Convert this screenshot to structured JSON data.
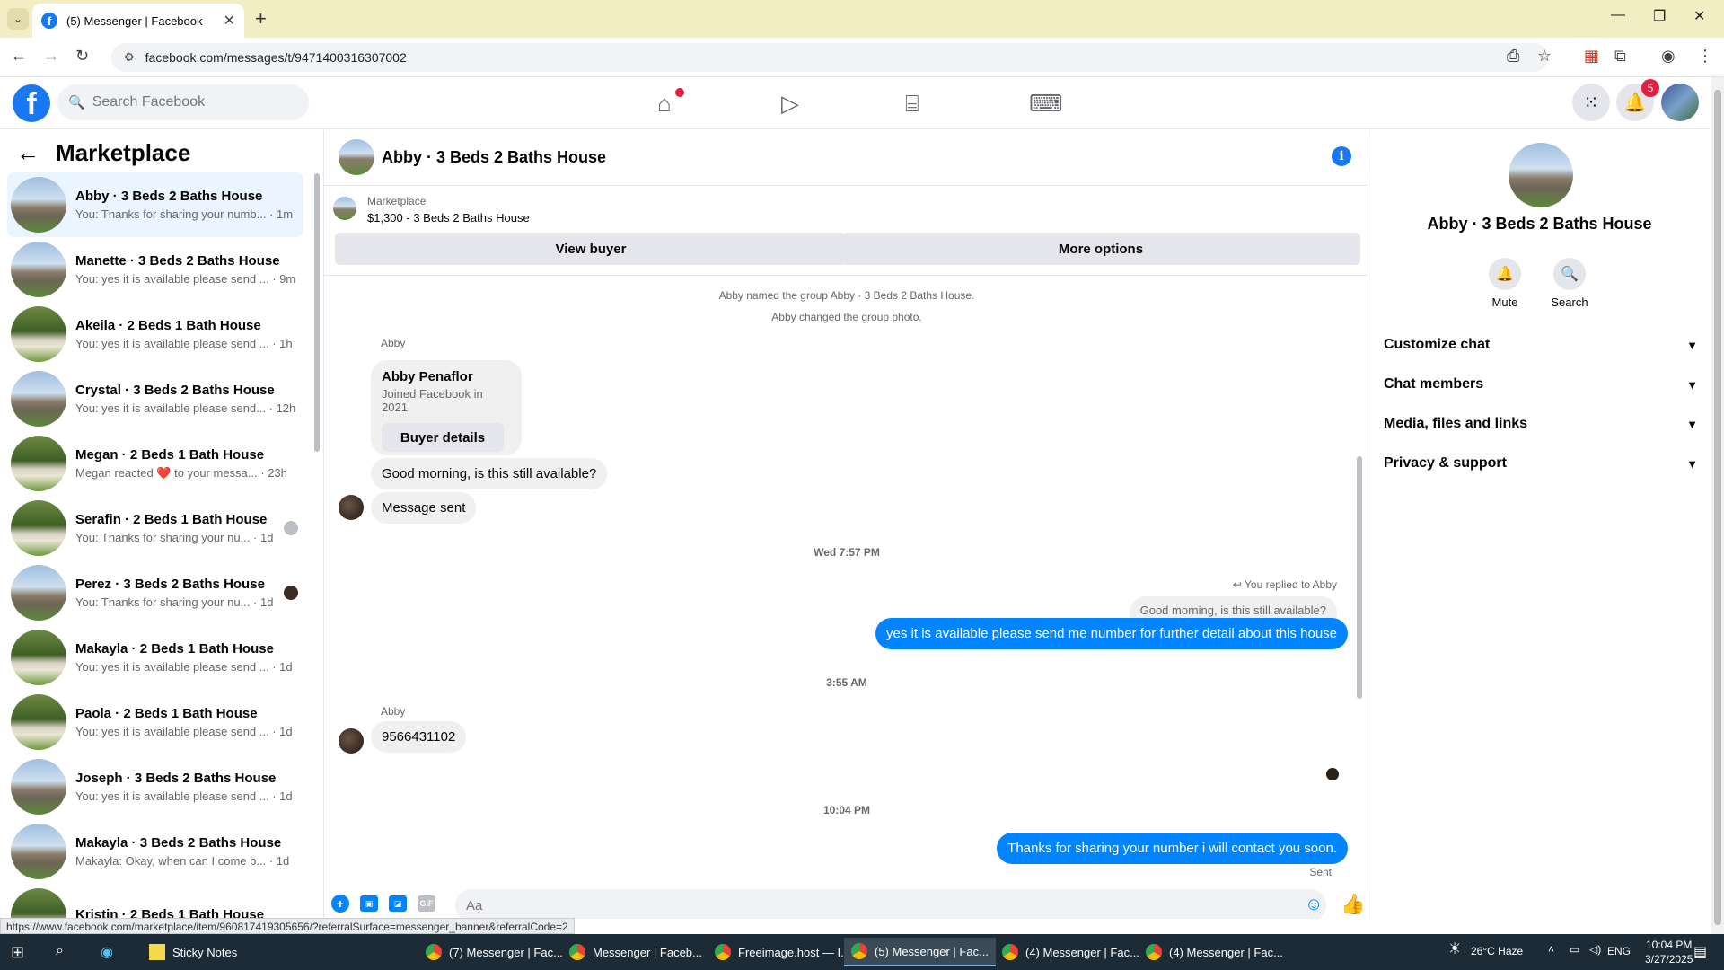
{
  "browser": {
    "tab_title": "(5) Messenger | Facebook",
    "url": "facebook.com/messages/t/9471400316307002"
  },
  "fb": {
    "search_placeholder": "Search Facebook",
    "notification_count": "5"
  },
  "left": {
    "title": "Marketplace",
    "conversations": [
      {
        "name": "Abby · 3 Beds 2 Baths House",
        "snippet": "You: Thanks for sharing your numb...",
        "time": "· 1m",
        "thumb": "house"
      },
      {
        "name": "Manette · 3 Beds 2 Baths House",
        "snippet": "You: yes it is available please send ...",
        "time": "· 9m",
        "thumb": "house"
      },
      {
        "name": "Akeila · 2 Beds 1 Bath House",
        "snippet": "You: yes it is available please send ...",
        "time": "· 1h",
        "thumb": "tree"
      },
      {
        "name": "Crystal · 3 Beds 2 Baths House",
        "snippet": "You: yes it is available please send...",
        "time": "· 12h",
        "thumb": "house"
      },
      {
        "name": "Megan · 2 Beds 1 Bath House",
        "snippet": "Megan reacted ❤️ to your messa...",
        "time": "· 23h",
        "thumb": "tree"
      },
      {
        "name": "Serafin · 2 Beds 1 Bath House",
        "snippet": "You: Thanks for sharing your nu...",
        "time": "· 1d",
        "thumb": "tree"
      },
      {
        "name": "Perez · 3 Beds 2 Baths House",
        "snippet": "You: Thanks for sharing your nu...",
        "time": "· 1d",
        "thumb": "house"
      },
      {
        "name": "Makayla · 2 Beds 1 Bath House",
        "snippet": "You: yes it is available please send ...",
        "time": "· 1d",
        "thumb": "tree"
      },
      {
        "name": "Paola · 2 Beds 1 Bath House",
        "snippet": "You: yes it is available please send ...",
        "time": "· 1d",
        "thumb": "tree"
      },
      {
        "name": "Joseph · 3 Beds 2 Baths House",
        "snippet": "You: yes it is available please send ...",
        "time": "· 1d",
        "thumb": "house"
      },
      {
        "name": "Makayla · 3 Beds 2 Baths House",
        "snippet": "Makayla: Okay, when can I come b...",
        "time": "· 1d",
        "thumb": "house"
      },
      {
        "name": "Kristin · 2 Beds 1 Bath House",
        "snippet": "",
        "time": "",
        "thumb": "tree"
      }
    ]
  },
  "chat": {
    "title": "Abby · 3 Beds 2 Baths House",
    "marketplace_label": "Marketplace",
    "listing": "$1,300 - 3 Beds 2 Baths House",
    "view_buyer": "View buyer",
    "more_options": "More options",
    "sys1": "Abby named the group Abby · 3 Beds 2 Baths House.",
    "sys2": "Abby changed the group photo.",
    "sender1": "Abby",
    "buyer_name": "Abby Penaflor",
    "buyer_joined": "Joined Facebook in 2021",
    "buyer_details": "Buyer details",
    "msg_in1": "Good morning, is this still available?",
    "msg_in2": "Message sent",
    "time1": "Wed 7:57 PM",
    "replied": "You replied to Abby",
    "quote": "Good morning, is this still available?",
    "msg_out1": "yes it is available please send me number for further detail about this house",
    "time2": "3:55 AM",
    "sender2": "Abby",
    "msg_in3": "9566431102",
    "time3": "10:04 PM",
    "msg_out2": "Thanks for sharing your number i will contact you soon.",
    "sent": "Sent",
    "composer_placeholder": "Aa"
  },
  "right": {
    "name": "Abby · 3 Beds 2 Baths House",
    "mute": "Mute",
    "search": "Search",
    "sections": [
      "Customize chat",
      "Chat members",
      "Media, files and links",
      "Privacy & support"
    ]
  },
  "status_url": "https://www.facebook.com/marketplace/item/960817419305656/?referralSurface=messenger_banner&referralCode=2",
  "taskbar": {
    "apps": [
      {
        "label": "Sticky Notes",
        "icon": "sticky"
      },
      {
        "label": "(7) Messenger | Fac...",
        "icon": "chrome"
      },
      {
        "label": "Messenger | Faceb...",
        "icon": "chrome"
      },
      {
        "label": "Freeimage.host — I...",
        "icon": "chrome"
      },
      {
        "label": "(5) Messenger | Fac...",
        "icon": "chrome",
        "active": true
      },
      {
        "label": "(4) Messenger | Fac...",
        "icon": "chrome"
      },
      {
        "label": "(4) Messenger | Fac...",
        "icon": "chrome"
      }
    ],
    "weather": "26°C  Haze",
    "lang": "ENG",
    "time": "10:04 PM",
    "date": "3/27/2025"
  },
  "colors": {
    "fb_blue": "#1877f2",
    "messenger_blue": "#0084ff",
    "active_conv_bg": "#ebf5ff",
    "chrome_tabstrip": "#f3edc4"
  }
}
